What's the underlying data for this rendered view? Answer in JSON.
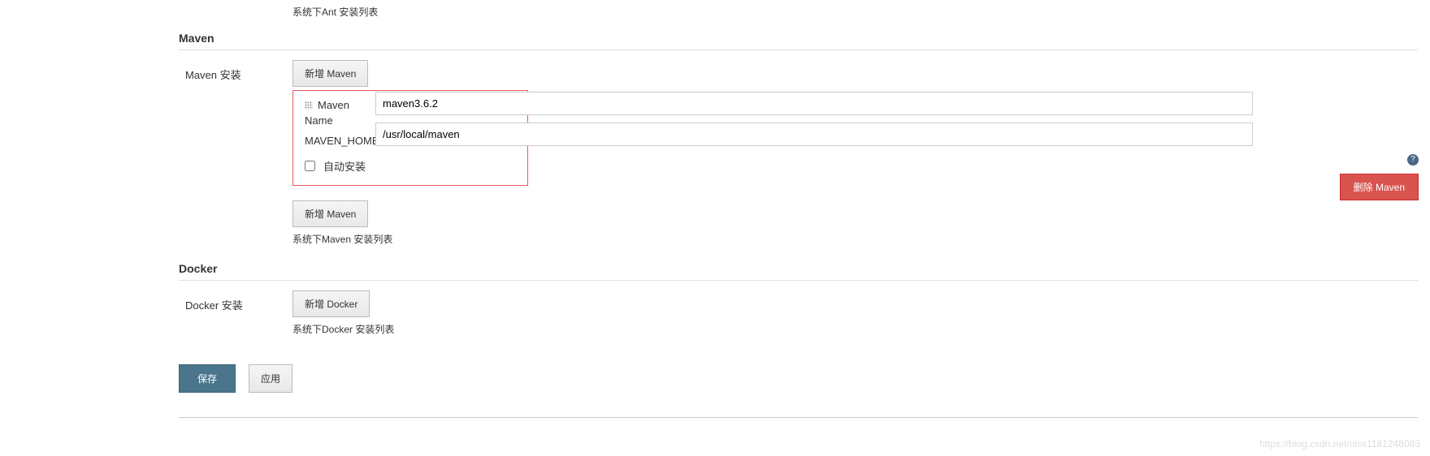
{
  "ant": {
    "list_desc": "系统下Ant 安装列表"
  },
  "maven": {
    "section_title": "Maven",
    "install_label": "Maven 安装",
    "add_button": "新增 Maven",
    "config_title": "Maven",
    "name_label": "Name",
    "name_value": "maven3.6.2",
    "home_label": "MAVEN_HOME",
    "home_value": "/usr/local/maven",
    "auto_install_label": "自动安装",
    "delete_button": "删除 Maven",
    "add_button_2": "新增 Maven",
    "list_desc": "系统下Maven 安装列表"
  },
  "docker": {
    "section_title": "Docker",
    "install_label": "Docker 安装",
    "add_button": "新增 Docker",
    "list_desc": "系统下Docker 安装列表"
  },
  "footer": {
    "save": "保存",
    "apply": "应用"
  },
  "watermark": "https://blog.csdn.net/niss1181248083"
}
